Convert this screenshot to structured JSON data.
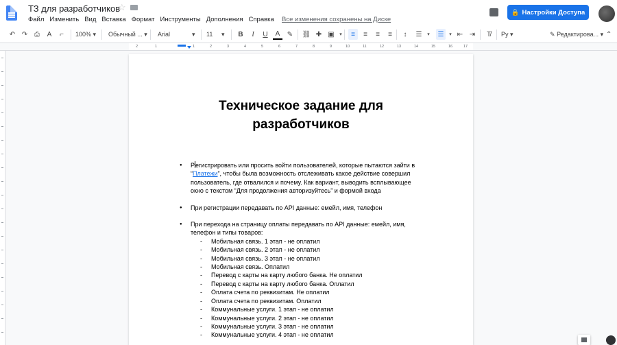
{
  "app": {
    "doc_title": "ТЗ для разработчиков",
    "save_status": "Все изменения сохранены на Диске",
    "share_label": "Настройки Доступа"
  },
  "menu": [
    "Файл",
    "Изменить",
    "Вид",
    "Вставка",
    "Формат",
    "Инструменты",
    "Дополнения",
    "Справка"
  ],
  "toolbar": {
    "zoom": "100%",
    "style": "Обычный ...",
    "font": "Arial",
    "font_size": "11",
    "input_lang": "Ру",
    "mode": "Редактирова..."
  },
  "ruler": [
    "2",
    "1",
    "1",
    "2",
    "3",
    "4",
    "5",
    "6",
    "7",
    "8",
    "9",
    "10",
    "11",
    "12",
    "13",
    "14",
    "15",
    "16",
    "17",
    "18"
  ],
  "document": {
    "title_line1": "Техническое задание для",
    "title_line2": "разработчиков",
    "p1_a": "Р",
    "p1_b": "егистрировать или просить войти пользователей, которые пытаются зайти в",
    "p1_quote": "“",
    "p1_link": "Платежи",
    "p1_c": "”, чтобы была возможность отслеживать какое действие совершил",
    "p1_d": "пользователь, где отвалился и почему. Как вариант, выводить всплывающее",
    "p1_e": "окно с текстом “Для продолжения авторизуйтесь” и формой входа",
    "p2": "При регистрации передавать по API данные: емейл, имя, телефон",
    "p3_a": "При перехода на страницу оплаты передавать по API данные: емейл, имя,",
    "p3_b": "телефон и типы товаров:",
    "items": [
      "Мобильная связь. 1 этап - не оплатил",
      "Мобильная связь. 2 этап - не оплатил",
      "Мобильная связь. 3 этап - не оплатил",
      "Мобильная связь. Оплатил",
      "Перевод с карты на карту любого банка. Не оплатил",
      "Перевод с карты на карту любого банка. Оплатил",
      "Оплата счета по реквизитам. Не оплатил",
      "Оплата счета по реквизитам. Оплатил",
      "Коммунальные услуги. 1 этап - не оплатил",
      "Коммунальные услуги. 2 этап - не оплатил",
      "Коммунальные услуги. 3 этап - не оплатил",
      "Коммунальные услуги. 4 этап - не оплатил"
    ]
  }
}
